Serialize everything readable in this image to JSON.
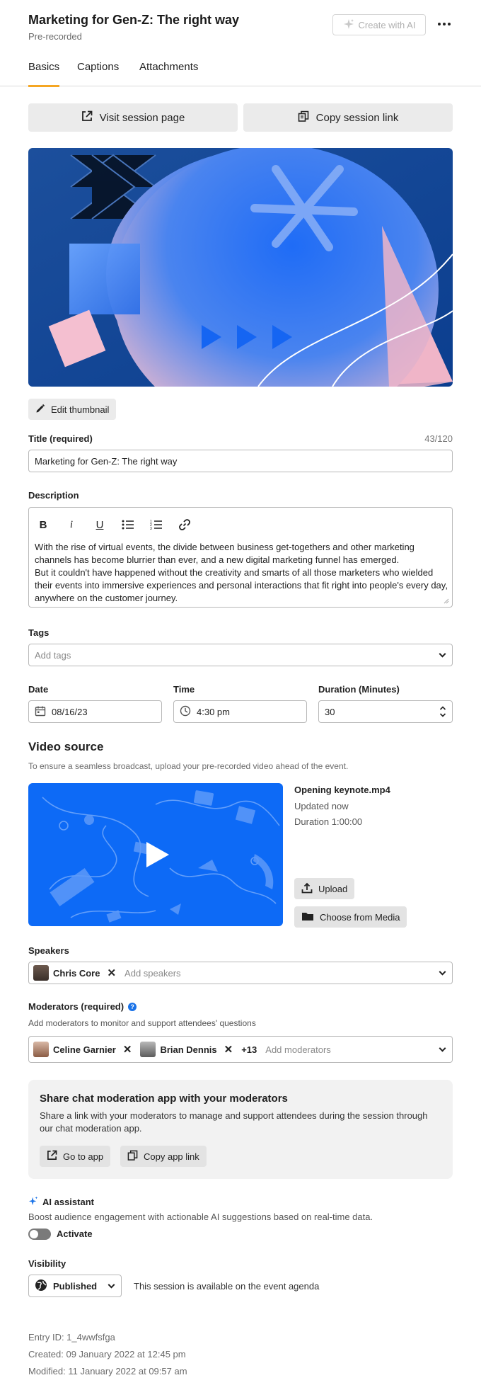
{
  "header": {
    "title": "Marketing for Gen-Z: The right way",
    "subtitle": "Pre-recorded",
    "create_ai_label": "Create with AI"
  },
  "tabs": [
    {
      "label": "Basics",
      "active": true
    },
    {
      "label": "Captions",
      "active": false
    },
    {
      "label": "Attachments",
      "active": false
    }
  ],
  "actions": {
    "visit_label": "Visit session page",
    "copy_label": "Copy session link"
  },
  "thumbnail": {
    "edit_label": "Edit thumbnail"
  },
  "title_field": {
    "label": "Title (required)",
    "counter": "43/120",
    "value": "Marketing for Gen-Z: The right way"
  },
  "description": {
    "label": "Description",
    "text": "With the rise of virtual events, the divide between business get-togethers and other marketing channels has become blurrier than ever, and a new digital marketing funnel has emerged.\nBut it couldn't have happened without the creativity and smarts of all those marketers who wielded their events into immersive experiences and personal interactions that fit right into people's every day, anywhere on the customer journey."
  },
  "tags": {
    "label": "Tags",
    "placeholder": "Add tags"
  },
  "schedule": {
    "date_label": "Date",
    "date_value": "08/16/23",
    "time_label": "Time",
    "time_value": "4:30 pm",
    "duration_label": "Duration (Minutes)",
    "duration_value": "30"
  },
  "video_source": {
    "heading": "Video source",
    "hint": "To ensure a seamless broadcast, upload your pre-recorded video ahead of the event.",
    "file_name": "Opening keynote.mp4",
    "updated": "Updated now",
    "duration": "Duration 1:00:00",
    "upload_label": "Upload",
    "choose_label": "Choose from Media"
  },
  "speakers": {
    "label": "Speakers",
    "chips": [
      "Chris Core"
    ],
    "placeholder": "Add speakers"
  },
  "moderators": {
    "label": "Moderators (required)",
    "hint": "Add moderators to monitor and support attendees' questions",
    "chips": [
      "Celine Garnier",
      "Brian Dennis"
    ],
    "more": "+13",
    "placeholder": "Add moderators"
  },
  "share": {
    "heading": "Share chat moderation app with your moderators",
    "text": "Share a link with your moderators to manage and support attendees during the session through our chat moderation app.",
    "go_label": "Go to app",
    "copy_label": "Copy app link"
  },
  "ai_assistant": {
    "label": "AI assistant",
    "text": "Boost audience engagement with actionable AI suggestions based on real-time data.",
    "toggle_label": "Activate",
    "active": false
  },
  "visibility": {
    "label": "Visibility",
    "value": "Published",
    "note": "This session is available on the event agenda"
  },
  "meta": {
    "entry_id": "Entry ID: 1_4wwfsfga",
    "created": "Created: 09 January 2022 at 12:45 pm",
    "modified": "Modified: 11 January 2022 at 09:57 am"
  },
  "colors": {
    "accent": "#f5a623",
    "brand_blue": "#0b6bf5",
    "info_blue": "#1a73e8"
  }
}
